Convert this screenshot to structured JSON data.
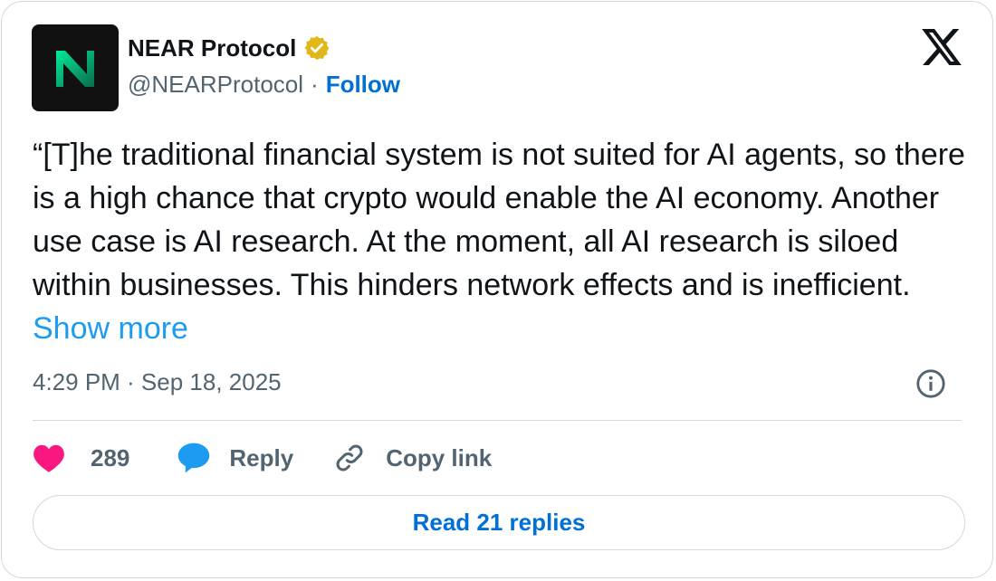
{
  "author": {
    "display_name": "NEAR Protocol",
    "handle": "@NEARProtocol",
    "separator": "·",
    "follow_label": "Follow",
    "verified": true
  },
  "tweet": {
    "text": "“[T]he traditional financial system is not suited for AI agents, so there is a high chance that crypto would enable the AI economy. Another use case is AI research. At the moment, all AI research is siloed within businesses. This hinders network effects and is inefficient. ",
    "show_more_label": "Show more",
    "timestamp": "4:29 PM · Sep 18, 2025"
  },
  "actions": {
    "like_count": "289",
    "reply_label": "Reply",
    "copy_link_label": "Copy link"
  },
  "read_replies_label": "Read 21 replies",
  "icons": {
    "logo": "x-logo-icon",
    "verified": "verified-badge-icon",
    "info": "info-icon",
    "like": "heart-icon",
    "reply": "speech-bubble-icon",
    "copy": "link-icon"
  },
  "colors": {
    "link": "#006fd6",
    "show_more": "#1d9bf0",
    "heart": "#f91880",
    "reply_bubble": "#1d9bf0",
    "verified_gold": "#e2b719",
    "avatar_accent": "#00ec97"
  }
}
